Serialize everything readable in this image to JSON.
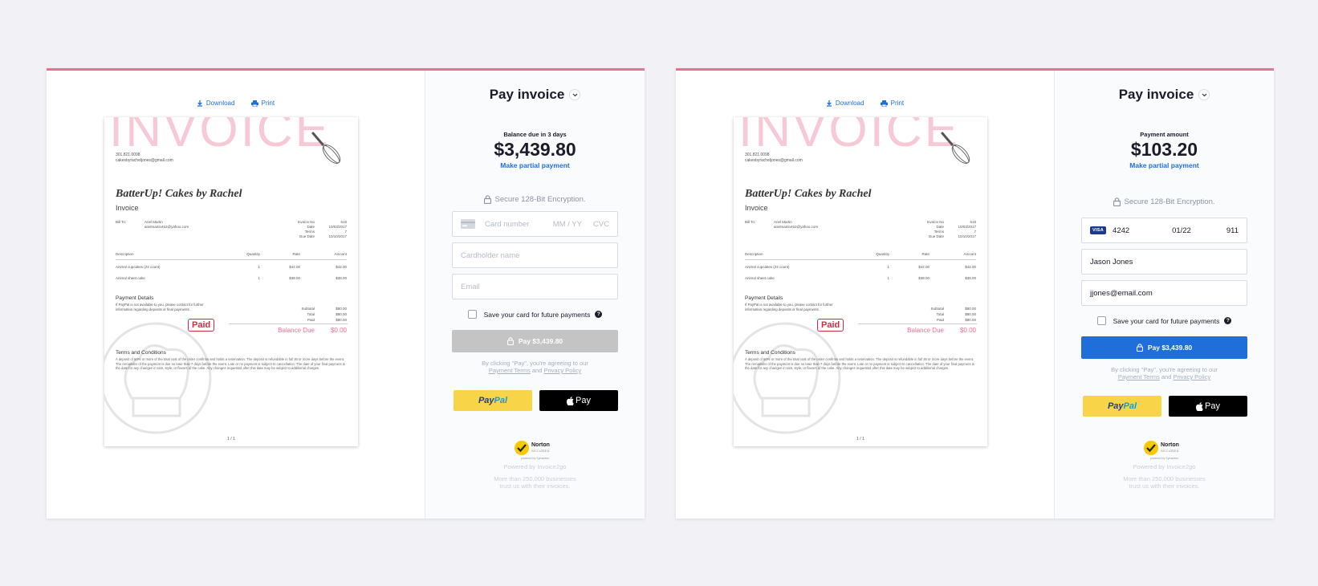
{
  "colors": {
    "accent_top": "#ef6f92",
    "link_blue": "#1e6fd9",
    "pay_disabled": "#c4c4c4",
    "pay_active": "#1e6fd9"
  },
  "toolbar": {
    "download": "Download",
    "print": "Print"
  },
  "invoice": {
    "watermark": "INVOICE",
    "phone": "301.821.0098",
    "email": "cakesbyracheljones@gmail.com",
    "business": "BatterUp! Cakes by Rachel",
    "subtitle": "Invoice",
    "bill_to_label": "Bill To:",
    "bill_to_name": "Ariel Martin",
    "bill_to_email": "arielmartin452@yahoo.com",
    "meta": [
      {
        "label": "Invoice No",
        "value": "618"
      },
      {
        "label": "Date",
        "value": "10/03/2017"
      },
      {
        "label": "Terms",
        "value": "7"
      },
      {
        "label": "Due Date",
        "value": "10/10/2017"
      }
    ],
    "columns": {
      "description": "Description",
      "quantity": "Quantity",
      "rate": "Rate",
      "amount": "Amount"
    },
    "items": [
      {
        "description": "Animal cupcakes (24 count)",
        "quantity": "1",
        "rate": "$42.00",
        "amount": "$42.00"
      },
      {
        "description": "Animal sheet cake",
        "quantity": "1",
        "rate": "$38.00",
        "amount": "$38.00"
      }
    ],
    "payment_details_title": "Payment Details",
    "payment_details_text": "If PayPal is not available to you, please contact for further information regarding deposits or final payments.",
    "totals": [
      {
        "label": "Subtotal",
        "value": "$80.00"
      },
      {
        "label": "Total",
        "value": "$80.00"
      },
      {
        "label": "Paid",
        "value": "$80.00"
      }
    ],
    "paid_stamp": "Paid",
    "balance_due_label": "Balance Due",
    "balance_due_value": "$0.00",
    "terms_title": "Terms and Conditions",
    "terms_text": "A deposit of 50% or more of the total cost of the order confirms and holds a reservation. The deposit is refundable in full 30 or more days before the event. The remainder of the payment is due no later than 7 days before the event. Late or no payment is subject to cancellation. The date of your final payment is the date for any changes in size, style, or flavors of the cake. Any changes requested after this date may be subject to additional charges.",
    "page": "1 / 1"
  },
  "panel1": {
    "title": "Pay invoice",
    "amount_label": "Balance due in 3 days",
    "amount": "$3,439.80",
    "partial": "Make partial payment",
    "secure": "Secure 128-Bit Encryption.",
    "card_placeholder": "Card number",
    "exp_placeholder": "MM / YY",
    "cvc_placeholder": "CVC",
    "name_placeholder": "Cardholder name",
    "email_placeholder": "Email",
    "save_label": "Save your card for future payments",
    "pay_label": "Pay $3,439.80",
    "agree_text": "By clicking \"Pay\", you're agreeing to our",
    "terms_link": "Payment Terms",
    "and": "and",
    "privacy_link": "Privacy Policy",
    "paypal_a": "Pay",
    "paypal_b": "Pal",
    "applepay": "Pay",
    "norton": "Norton",
    "norton_secured": "SECURED",
    "norton_sub": "powered by Symantec",
    "powered": "Powered by Invoice2go",
    "footnote_1": "More than 250,000 businesses",
    "footnote_2": "trust us with their invoices."
  },
  "panel2": {
    "title": "Pay invoice",
    "amount_label": "Payment amount",
    "amount": "$103.20",
    "partial": "Make partial payment",
    "secure": "Secure 128-Bit Encryption.",
    "card_brand": "VISA",
    "card_number": "4242",
    "exp": "01/22",
    "cvc": "911",
    "name": "Jason Jones",
    "email": "jjones@email.com",
    "save_label": "Save your card for future payments",
    "pay_label": "Pay $3,439.80",
    "agree_text": "By clicking \"Pay\", you're agreeing to our",
    "terms_link": "Payment Terms",
    "and": "and",
    "privacy_link": "Privacy Policy",
    "paypal_a": "Pay",
    "paypal_b": "Pal",
    "applepay": "Pay",
    "norton": "Norton",
    "norton_secured": "SECURED",
    "norton_sub": "powered by Symantec",
    "powered": "Powered by Invoice2go",
    "footnote_1": "More than 250,000 businesses",
    "footnote_2": "trust us with their invoices."
  }
}
